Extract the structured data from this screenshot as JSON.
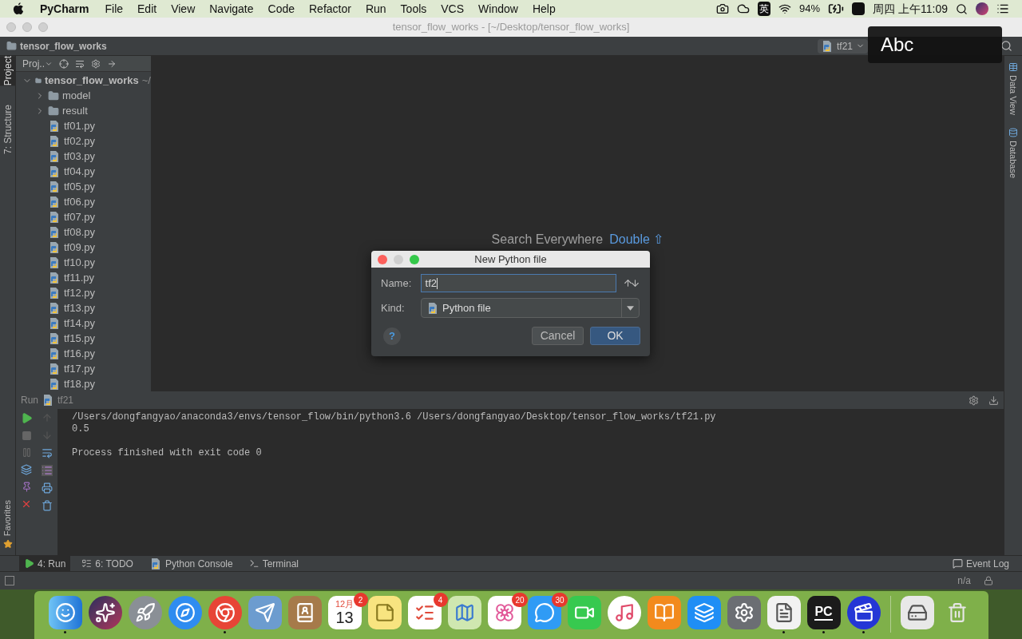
{
  "menubar": {
    "app": "PyCharm",
    "items": [
      "File",
      "Edit",
      "View",
      "Navigate",
      "Code",
      "Refactor",
      "Run",
      "Tools",
      "VCS",
      "Window",
      "Help"
    ],
    "ime": "英",
    "battery": "94%",
    "clock": "周四 上午11:09"
  },
  "window": {
    "title": "tensor_flow_works - [~/Desktop/tensor_flow_works]"
  },
  "navbar": {
    "breadcrumb": "tensor_flow_works",
    "run_config": "tf21"
  },
  "input_indicator": "Abc",
  "left_tool_tabs": [
    {
      "label": "Project",
      "selected": true
    },
    {
      "label": "7: Structure",
      "selected": false
    }
  ],
  "favorites_tab": "Favorites",
  "project_panel": {
    "title": "Proj..",
    "tree": [
      {
        "label": "tensor_flow_works",
        "path": "~/",
        "kind": "folder",
        "expanded": true,
        "children": [
          {
            "label": "model",
            "kind": "folder",
            "expanded": false
          },
          {
            "label": "result",
            "kind": "folder",
            "expanded": false
          },
          {
            "label": "tf01.py",
            "kind": "file"
          },
          {
            "label": "tf02.py",
            "kind": "file"
          },
          {
            "label": "tf03.py",
            "kind": "file"
          },
          {
            "label": "tf04.py",
            "kind": "file"
          },
          {
            "label": "tf05.py",
            "kind": "file"
          },
          {
            "label": "tf06.py",
            "kind": "file"
          },
          {
            "label": "tf07.py",
            "kind": "file"
          },
          {
            "label": "tf08.py",
            "kind": "file"
          },
          {
            "label": "tf09.py",
            "kind": "file"
          },
          {
            "label": "tf10.py",
            "kind": "file"
          },
          {
            "label": "tf11.py",
            "kind": "file"
          },
          {
            "label": "tf12.py",
            "kind": "file"
          },
          {
            "label": "tf13.py",
            "kind": "file"
          },
          {
            "label": "tf14.py",
            "kind": "file"
          },
          {
            "label": "tf15.py",
            "kind": "file"
          },
          {
            "label": "tf16.py",
            "kind": "file"
          },
          {
            "label": "tf17.py",
            "kind": "file"
          },
          {
            "label": "tf18.py",
            "kind": "file"
          }
        ]
      }
    ]
  },
  "editor": {
    "hint": "Search Everywhere",
    "shortcut": "Double ⇧"
  },
  "dialog": {
    "title": "New Python file",
    "name_label": "Name:",
    "name_value": "tf2",
    "kind_label": "Kind:",
    "kind_value": "Python file",
    "help": "?",
    "buttons": [
      {
        "label": "Cancel",
        "default": false
      },
      {
        "label": "OK",
        "default": true
      }
    ]
  },
  "right_tool_tabs": [
    "Data View",
    "Database"
  ],
  "run_panel": {
    "title": "Run",
    "config": "tf21",
    "output_blocks": [
      [
        "/Users/dongfangyao/anaconda3/envs/tensor_flow/bin/python3.6 /Users/dongfangyao/Desktop/tensor_flow_works/tf21.py",
        "0.5"
      ],
      [
        "Process finished with exit code 0"
      ]
    ]
  },
  "bottom_tabs": [
    {
      "label": "4: Run",
      "kind": "run",
      "selected": true
    },
    {
      "label": "6: TODO",
      "kind": "todo",
      "selected": false
    },
    {
      "label": "Python Console",
      "kind": "console",
      "selected": false
    },
    {
      "label": "Terminal",
      "kind": "terminal",
      "selected": false
    }
  ],
  "event_log": "Event Log",
  "status_bar": {
    "text": "n/a"
  },
  "dock": [
    {
      "kind": "finder",
      "running": true
    },
    {
      "kind": "siri",
      "running": false
    },
    {
      "kind": "launchpad",
      "running": false
    },
    {
      "kind": "safari",
      "running": false
    },
    {
      "kind": "chrome",
      "running": true
    },
    {
      "kind": "mail",
      "running": false
    },
    {
      "kind": "contacts",
      "running": false
    },
    {
      "kind": "calendar",
      "month": "12月",
      "day": "13",
      "badge": "2",
      "running": false
    },
    {
      "kind": "notes",
      "running": false
    },
    {
      "kind": "reminders",
      "badge": "4",
      "running": false
    },
    {
      "kind": "maps",
      "running": false
    },
    {
      "kind": "photos",
      "badge": "20",
      "running": false
    },
    {
      "kind": "messages",
      "badge": "30",
      "running": false
    },
    {
      "kind": "facetime",
      "running": false
    },
    {
      "kind": "music",
      "running": false
    },
    {
      "kind": "books",
      "running": false
    },
    {
      "kind": "appstore",
      "running": false
    },
    {
      "kind": "settings",
      "running": false
    },
    {
      "kind": "textedit",
      "running": true
    },
    {
      "kind": "pycharm",
      "label": "PC",
      "running": true
    },
    {
      "kind": "video",
      "running": true
    },
    {
      "kind": "separator"
    },
    {
      "kind": "drive",
      "running": false
    },
    {
      "kind": "trash",
      "running": false
    }
  ]
}
